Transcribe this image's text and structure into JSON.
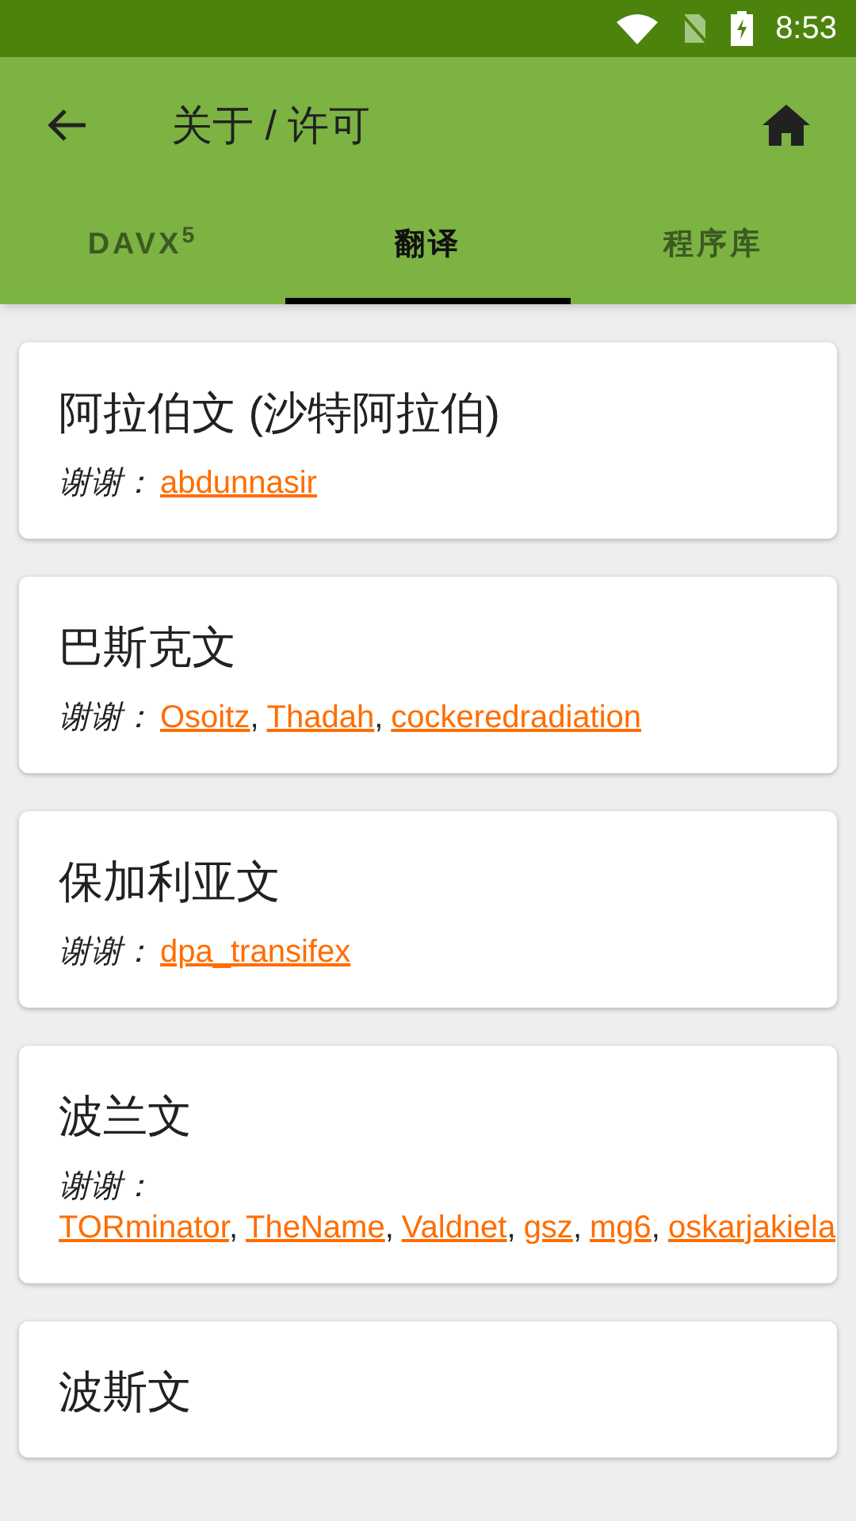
{
  "status_bar": {
    "time": "8:53"
  },
  "app_bar": {
    "title": "关于 / 许可"
  },
  "tabs": [
    {
      "label": "DAVX$^{5}$",
      "selected": false
    },
    {
      "label": "翻译",
      "selected": true
    },
    {
      "label": "程序库",
      "selected": false
    }
  ],
  "credit_separator": ",",
  "languages": [
    {
      "name": "阿拉伯文 (沙特阿拉伯)",
      "thanks_label": "谢谢：",
      "translators": [
        "abdunnasir"
      ]
    },
    {
      "name": "巴斯克文",
      "thanks_label": "谢谢：",
      "translators": [
        "Osoitz",
        "Thadah",
        "cockeredradiation"
      ]
    },
    {
      "name": "保加利亚文",
      "thanks_label": "谢谢：",
      "translators": [
        "dpa_transifex"
      ]
    },
    {
      "name": "波兰文",
      "thanks_label": "谢谢：",
      "translators": [
        "TORminator",
        "TheName",
        "Valdnet",
        "gsz",
        "mg6",
        "oskarjakiela"
      ]
    },
    {
      "name": "波斯文"
    }
  ]
}
